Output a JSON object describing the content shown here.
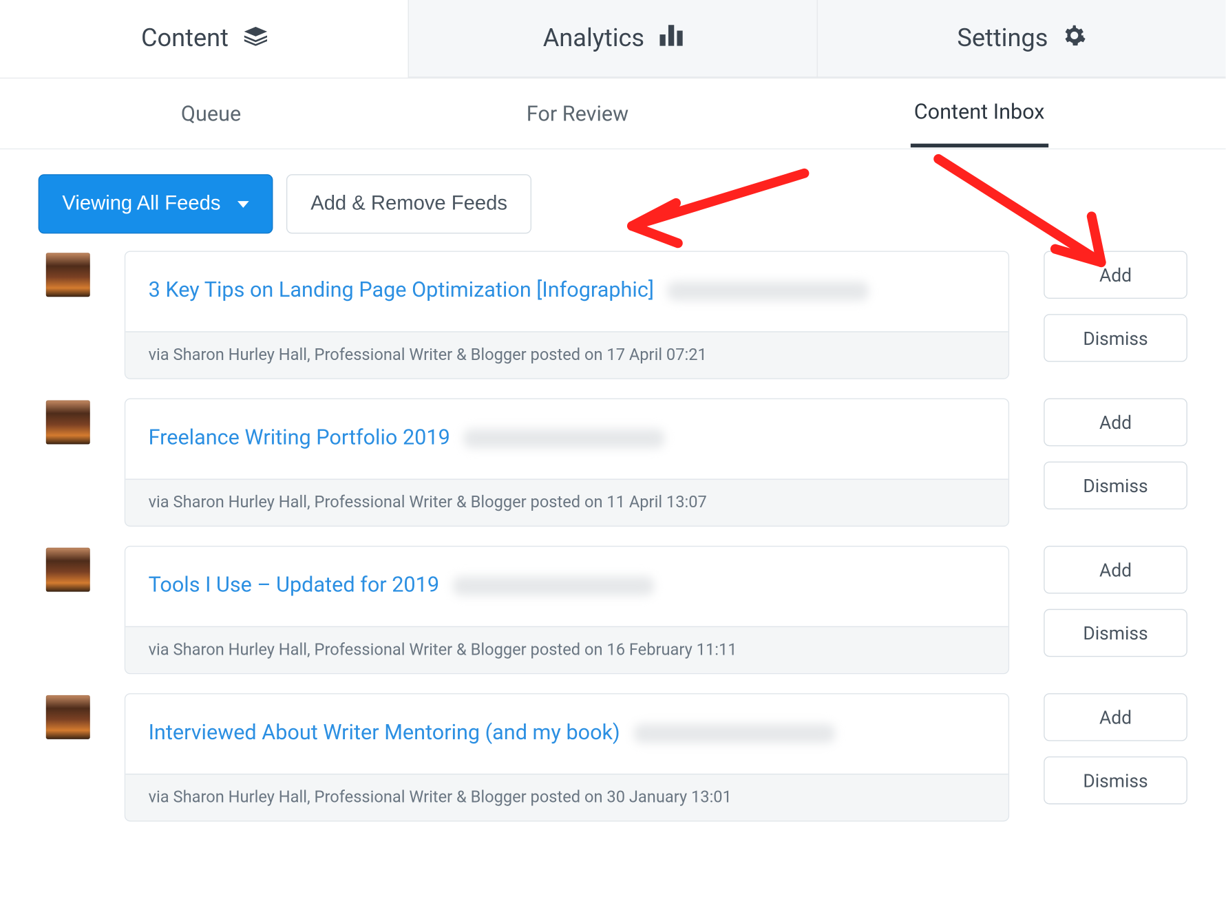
{
  "topnav": {
    "tabs": [
      {
        "label": "Content",
        "icon": "layers-icon",
        "active": true
      },
      {
        "label": "Analytics",
        "icon": "bars-icon",
        "active": false
      },
      {
        "label": "Settings",
        "icon": "gear-icon",
        "active": false
      }
    ]
  },
  "subnav": {
    "items": [
      {
        "label": "Queue",
        "active": false
      },
      {
        "label": "For Review",
        "active": false
      },
      {
        "label": "Content Inbox",
        "active": true
      }
    ]
  },
  "toolbar": {
    "viewing_label": "Viewing All Feeds",
    "add_remove_label": "Add & Remove Feeds"
  },
  "actions": {
    "add_label": "Add",
    "dismiss_label": "Dismiss"
  },
  "feed": [
    {
      "title": "3 Key Tips on Landing Page Optimization [Infographic]",
      "meta": "via Sharon Hurley Hall, Professional Writer & Blogger posted on 17 April 07:21"
    },
    {
      "title": "Freelance Writing Portfolio 2019",
      "meta": "via Sharon Hurley Hall, Professional Writer & Blogger posted on 11 April 13:07"
    },
    {
      "title": "Tools I Use – Updated for 2019",
      "meta": "via Sharon Hurley Hall, Professional Writer & Blogger posted on 16 February 11:11"
    },
    {
      "title": "Interviewed About Writer Mentoring (and my book)",
      "meta": "via Sharon Hurley Hall, Professional Writer & Blogger posted on 30 January 13:01"
    }
  ]
}
